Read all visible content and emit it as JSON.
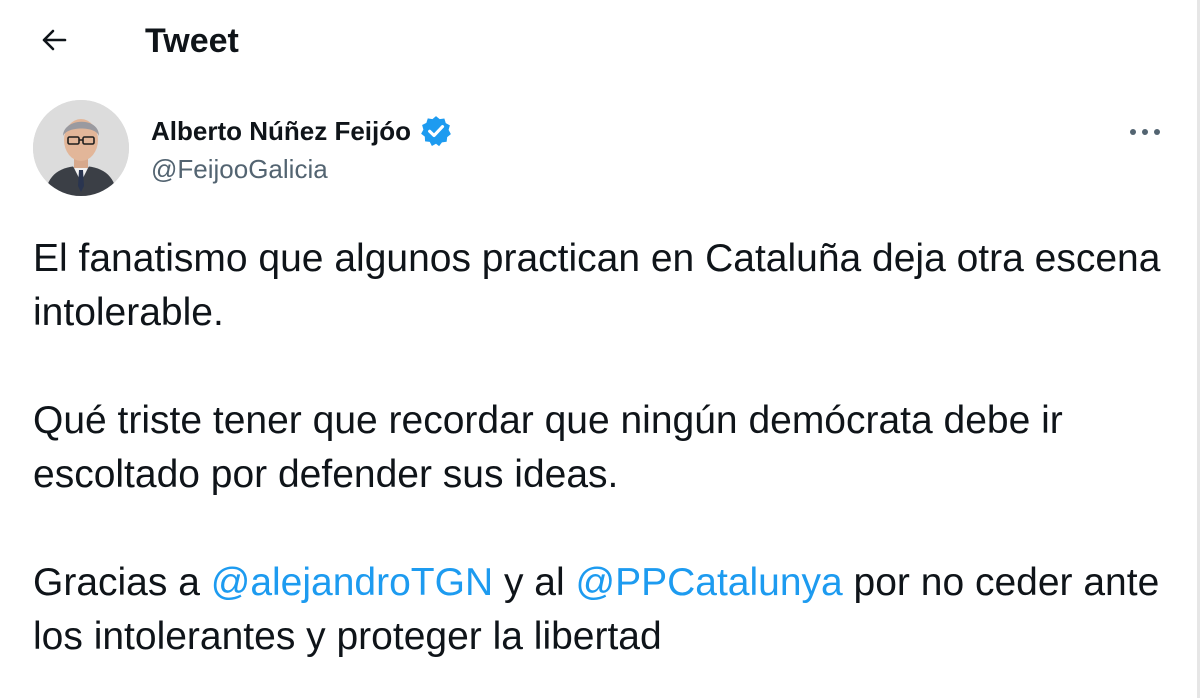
{
  "header": {
    "back_icon": "arrow-left-icon",
    "title": "Tweet"
  },
  "author": {
    "avatar_icon": "profile-photo",
    "display_name": "Alberto Núñez Feijóo",
    "verified_icon": "verified-badge-icon",
    "handle": "@FeijooGalicia",
    "more_icon": "more-horizontal-icon"
  },
  "tweet": {
    "paragraph1": "El fanatismo que algunos practican en Cataluña deja otra escena intolerable.",
    "paragraph2": "Qué triste tener que recordar que ningún demócrata debe ir escoltado por defender sus ideas.",
    "paragraph3": {
      "part1": "Gracias a ",
      "mention1": "@alejandroTGN",
      "part2": " y al ",
      "mention2": "@PPCatalunya",
      "part3": " por no ceder ante los intolerantes y proteger la libertad"
    }
  },
  "colors": {
    "accent": "#1d9bf0",
    "text": "#0f1419",
    "secondary_text": "#536471"
  }
}
